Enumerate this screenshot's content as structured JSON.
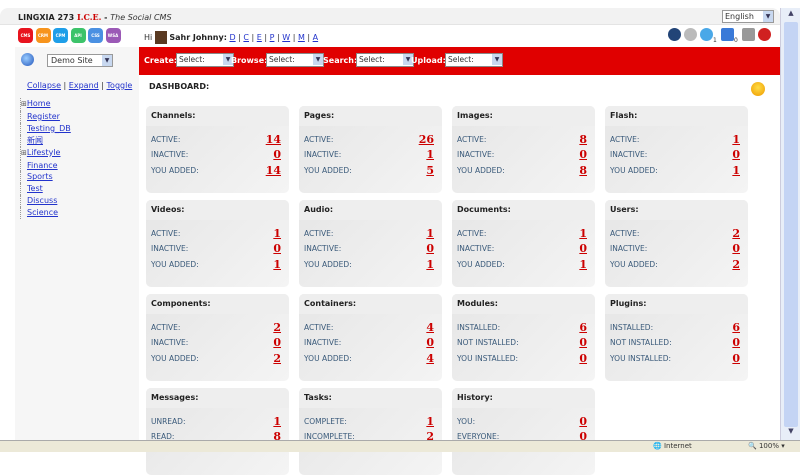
{
  "header": {
    "brand": "LINGXIA 273",
    "ice": "I.C.E.",
    "sep": " - ",
    "subtitle": "The Social CMS",
    "language": "English"
  },
  "apps": [
    {
      "label": "CMS",
      "color": "#e8141e"
    },
    {
      "label": "CRM",
      "color": "#f7941d"
    },
    {
      "label": "CPM",
      "color": "#1e9ee8"
    },
    {
      "label": "API",
      "color": "#3cc36a"
    },
    {
      "label": "CSS",
      "color": "#4a90e2"
    },
    {
      "label": "WSA",
      "color": "#9b59b6"
    }
  ],
  "user": {
    "greeting": "Hi",
    "name": "Sahr Johnny:",
    "links": [
      "D",
      "C",
      "E",
      "P",
      "W",
      "M",
      "A"
    ]
  },
  "toolbar_icons": [
    {
      "name": "home-icon"
    },
    {
      "name": "settings-icon"
    },
    {
      "name": "sync-icon",
      "count": "1"
    },
    {
      "name": "inbox-icon",
      "count": "0"
    },
    {
      "name": "database-icon"
    },
    {
      "name": "logout-icon"
    }
  ],
  "site_select": "Demo Site",
  "redbar": [
    {
      "label": "Create:",
      "value": "Select:"
    },
    {
      "label": "Browse:",
      "value": "Select:"
    },
    {
      "label": "Search:",
      "value": "Select:"
    },
    {
      "label": "Upload:",
      "value": "Select:"
    }
  ],
  "sidebar": {
    "collapse": "Collapse",
    "expand": "Expand",
    "toggle": "Toggle",
    "sep": "|",
    "tree": [
      {
        "label": "Home",
        "exp": true
      },
      {
        "label": "Register"
      },
      {
        "label": "Testing_DB"
      },
      {
        "label": "新闻"
      },
      {
        "label": "Lifestyle",
        "exp": true
      },
      {
        "label": "Finance"
      },
      {
        "label": "Sports"
      },
      {
        "label": "Test"
      },
      {
        "label": "Discuss"
      },
      {
        "label": "Science"
      }
    ]
  },
  "dashboard": {
    "title": "DASHBOARD:",
    "cards": [
      {
        "title": "Channels:",
        "rows": [
          [
            "ACTIVE:",
            "14"
          ],
          [
            "INACTIVE:",
            "0"
          ],
          [
            "YOU ADDED:",
            "14"
          ]
        ]
      },
      {
        "title": "Pages:",
        "rows": [
          [
            "ACTIVE:",
            "26"
          ],
          [
            "INACTIVE:",
            "1"
          ],
          [
            "YOU ADDED:",
            "5"
          ]
        ]
      },
      {
        "title": "Images:",
        "rows": [
          [
            "ACTIVE:",
            "8"
          ],
          [
            "INACTIVE:",
            "0"
          ],
          [
            "YOU ADDED:",
            "8"
          ]
        ]
      },
      {
        "title": "Flash:",
        "rows": [
          [
            "ACTIVE:",
            "1"
          ],
          [
            "INACTIVE:",
            "0"
          ],
          [
            "YOU ADDED:",
            "1"
          ]
        ]
      },
      {
        "title": "Videos:",
        "rows": [
          [
            "ACTIVE:",
            "1"
          ],
          [
            "INACTIVE:",
            "0"
          ],
          [
            "YOU ADDED:",
            "1"
          ]
        ]
      },
      {
        "title": "Audio:",
        "rows": [
          [
            "ACTIVE:",
            "1"
          ],
          [
            "INACTIVE:",
            "0"
          ],
          [
            "YOU ADDED:",
            "1"
          ]
        ]
      },
      {
        "title": "Documents:",
        "rows": [
          [
            "ACTIVE:",
            "1"
          ],
          [
            "INACTIVE:",
            "0"
          ],
          [
            "YOU ADDED:",
            "1"
          ]
        ]
      },
      {
        "title": "Users:",
        "rows": [
          [
            "ACTIVE:",
            "2"
          ],
          [
            "INACTIVE:",
            "0"
          ],
          [
            "YOU ADDED:",
            "2"
          ]
        ]
      },
      {
        "title": "Components:",
        "rows": [
          [
            "ACTIVE:",
            "2"
          ],
          [
            "INACTIVE:",
            "0"
          ],
          [
            "YOU ADDED:",
            "2"
          ]
        ]
      },
      {
        "title": "Containers:",
        "rows": [
          [
            "ACTIVE:",
            "4"
          ],
          [
            "INACTIVE:",
            "0"
          ],
          [
            "YOU ADDED:",
            "4"
          ]
        ]
      },
      {
        "title": "Modules:",
        "rows": [
          [
            "INSTALLED:",
            "6"
          ],
          [
            "NOT INSTALLED:",
            "0"
          ],
          [
            "YOU INSTALLED:",
            "0"
          ]
        ]
      },
      {
        "title": "Plugins:",
        "rows": [
          [
            "INSTALLED:",
            "6"
          ],
          [
            "NOT INSTALLED:",
            "0"
          ],
          [
            "YOU INSTALLED:",
            "0"
          ]
        ]
      },
      {
        "title": "Messages:",
        "rows": [
          [
            "UNREAD:",
            "1"
          ],
          [
            "READ:",
            "8"
          ]
        ]
      },
      {
        "title": "Tasks:",
        "rows": [
          [
            "COMPLETE:",
            "1"
          ],
          [
            "INCOMPLETE:",
            "2"
          ]
        ]
      },
      {
        "title": "History:",
        "rows": [
          [
            "YOU:",
            "0"
          ],
          [
            "EVERYONE:",
            "0"
          ]
        ]
      }
    ]
  },
  "statusbar": {
    "zone": "Internet",
    "zoom": "100%"
  }
}
